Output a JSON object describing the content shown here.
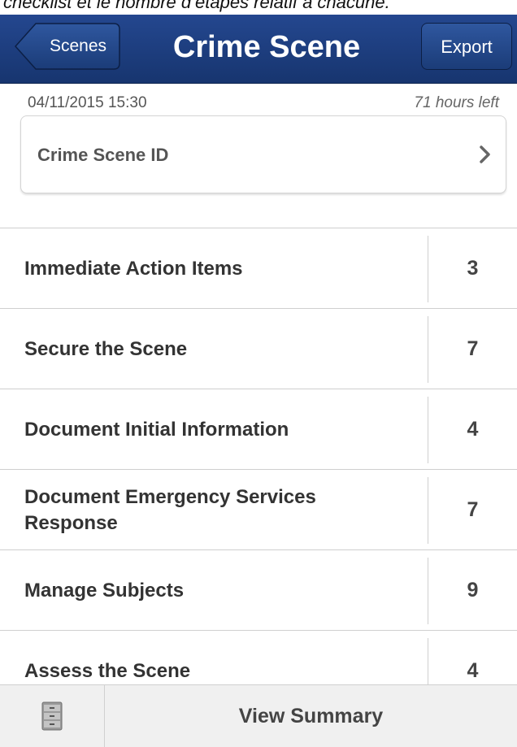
{
  "caption": "checklist et le nombre d’étapes relatif à chacune.",
  "navbar": {
    "back_label": "Scenes",
    "title": "Crime Scene",
    "export_label": "Export"
  },
  "meta": {
    "datetime": "04/11/2015   15:30",
    "time_left": "71 hours left"
  },
  "id_card": {
    "label": "Crime Scene ID",
    "chevron_icon": "chevron-right-icon"
  },
  "checklist": [
    {
      "label": "Immediate Action Items",
      "count": "3"
    },
    {
      "label": "Secure the Scene",
      "count": "7"
    },
    {
      "label": "Document Initial Information",
      "count": "4"
    },
    {
      "label": "Document Emergency Services Response",
      "count": "7"
    },
    {
      "label": "Manage Subjects",
      "count": "9"
    },
    {
      "label": "Assess the Scene",
      "count": "4"
    }
  ],
  "toolbar": {
    "cabinet_icon": "file-cabinet-icon",
    "summary_label": "View Summary"
  },
  "colors": {
    "navbar": "#1d3f7f",
    "text": "#333333",
    "divider": "#cfcfcf",
    "toolbar": "#f0f0f0"
  }
}
